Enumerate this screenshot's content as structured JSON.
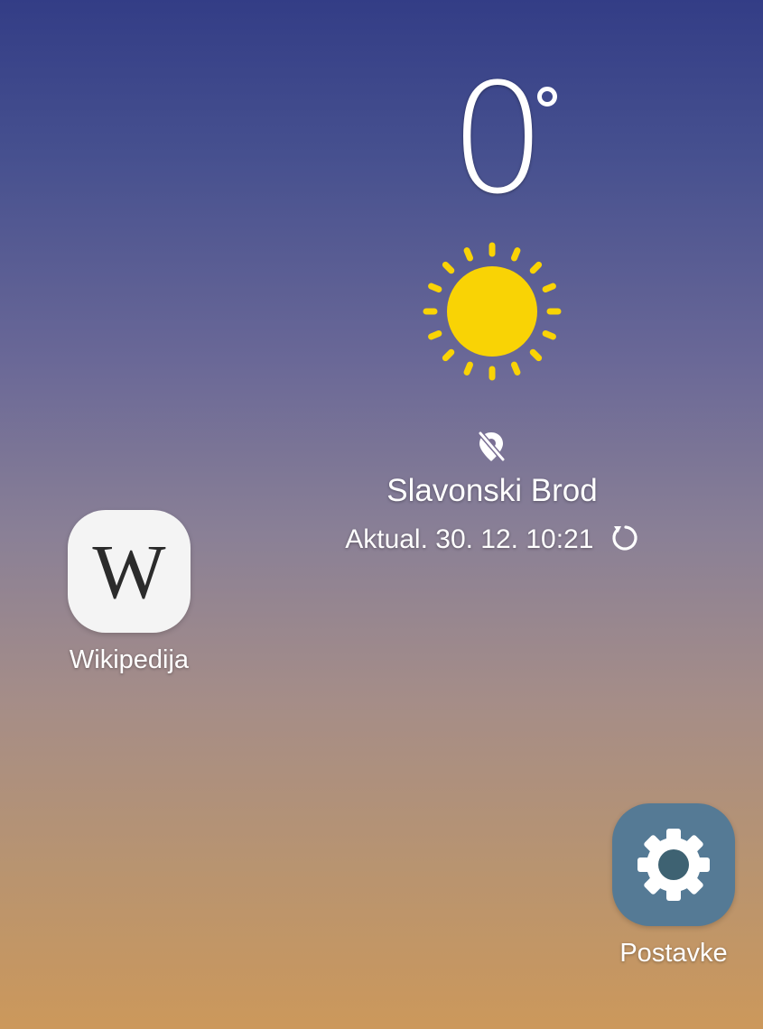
{
  "weather": {
    "temperature": "0",
    "condition_icon": "sun-icon",
    "location_icon": "location-off-icon",
    "city": "Slavonski Brod",
    "updated": "Aktual. 30. 12. 10:21",
    "refresh_icon": "refresh-icon",
    "sun_color": "#f9d305"
  },
  "apps": {
    "wikipedia": {
      "label": "Wikipedija",
      "glyph": "W",
      "icon": "wikipedia-icon"
    },
    "settings": {
      "label": "Postavke",
      "icon": "gear-icon",
      "color": "#557a95"
    }
  }
}
